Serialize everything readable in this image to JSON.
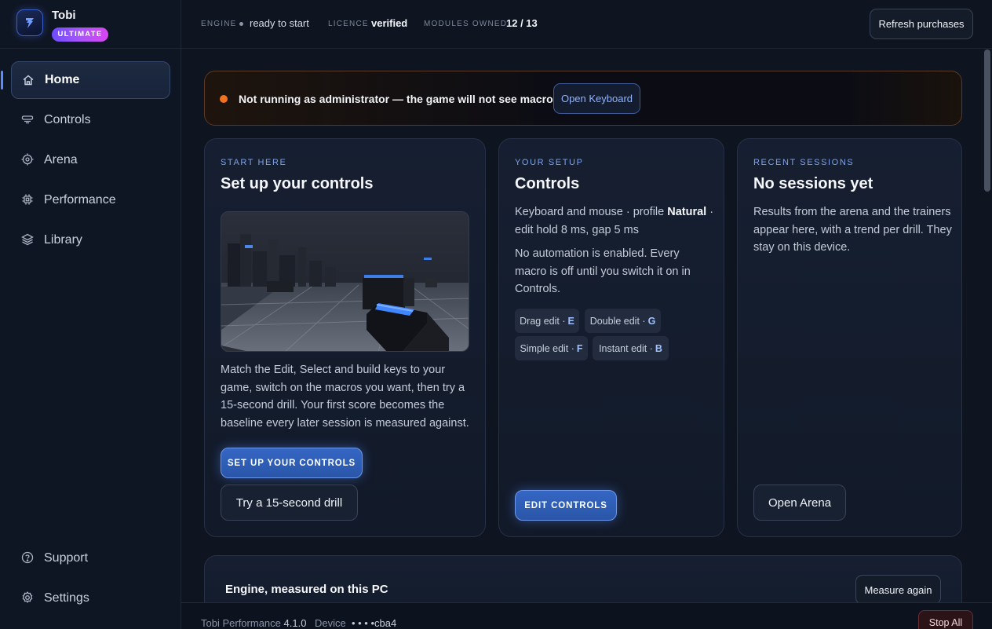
{
  "brand": {
    "name": "Tobi",
    "tier": "ULTIMATE",
    "logo_icon": "bolt-icon"
  },
  "sidebar": {
    "items": [
      {
        "label": "Home",
        "icon": "home-icon",
        "active": true
      },
      {
        "label": "Controls",
        "icon": "controller-icon"
      },
      {
        "label": "Arena",
        "icon": "crosshair-icon"
      },
      {
        "label": "Performance",
        "icon": "chip-icon"
      },
      {
        "label": "Library",
        "icon": "layers-icon"
      }
    ],
    "bottom_items": [
      {
        "label": "Support",
        "icon": "help-circle-icon"
      },
      {
        "label": "Settings",
        "icon": "gear-icon"
      }
    ]
  },
  "topbar": {
    "engine_key": "ENGINE",
    "engine_value": "ready to start",
    "licence_key": "LICENCE",
    "licence_value": "verified",
    "modules_key": "MODULES OWNED",
    "modules_value": "12 / 13",
    "refresh_label": "Refresh purchases"
  },
  "alert": {
    "text": "Not running as administrator — the game will not see macros",
    "button": "Open Keyboard",
    "color": "#f2731d"
  },
  "cards": {
    "start": {
      "eyebrow": "START HERE",
      "title": "Set up your controls",
      "body": "Match the Edit, Select and build keys to your game, switch on the macros you want, then try a 15-second drill. Your first score becomes the baseline every later session is measured against.",
      "primary": "SET UP YOUR CONTROLS",
      "secondary": "Try a 15-second drill"
    },
    "setup": {
      "eyebrow": "YOUR SETUP",
      "title": "Controls",
      "line1_pre": "Keyboard and mouse · profile ",
      "profile": "Natural",
      "line1_post": " · edit hold 8 ms, gap 5 ms",
      "body": "No automation is enabled. Every macro is off until you switch it on in Controls.",
      "chips": [
        {
          "label": "Drag edit ·",
          "key": "E"
        },
        {
          "label": "Double edit ·",
          "key": "G"
        },
        {
          "label": "Simple edit ·",
          "key": "F"
        },
        {
          "label": "Instant edit ·",
          "key": "B"
        }
      ],
      "primary": "EDIT CONTROLS"
    },
    "sessions": {
      "eyebrow": "RECENT SESSIONS",
      "title": "No sessions yet",
      "body": "Results from the arena and the trainers appear here, with a trend per drill. They stay on this device.",
      "secondary": "Open Arena"
    }
  },
  "engine": {
    "title": "Engine, measured on this PC",
    "button": "Measure again"
  },
  "footer": {
    "product": "Tobi Performance",
    "version": "4.1.0",
    "device_label": "Device",
    "device_id": "• • • •cba4",
    "stop": "Stop All"
  },
  "colors": {
    "accent": "#5b8bff",
    "warning": "#f2731d",
    "background": "#0e1420"
  }
}
